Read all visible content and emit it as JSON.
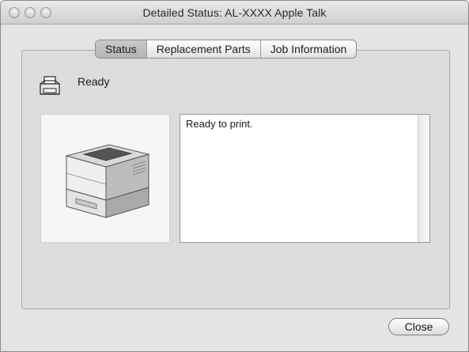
{
  "window": {
    "title": "Detailed Status: AL-XXXX  Apple Talk"
  },
  "tabs": [
    {
      "label": "Status",
      "selected": true
    },
    {
      "label": "Replacement Parts",
      "selected": false
    },
    {
      "label": "Job Information",
      "selected": false
    }
  ],
  "status": {
    "label": "Ready",
    "icon": "printer-status-icon"
  },
  "printer_image": {
    "icon": "printer-image"
  },
  "message": {
    "text": "Ready to print."
  },
  "buttons": {
    "close_label": "Close"
  }
}
